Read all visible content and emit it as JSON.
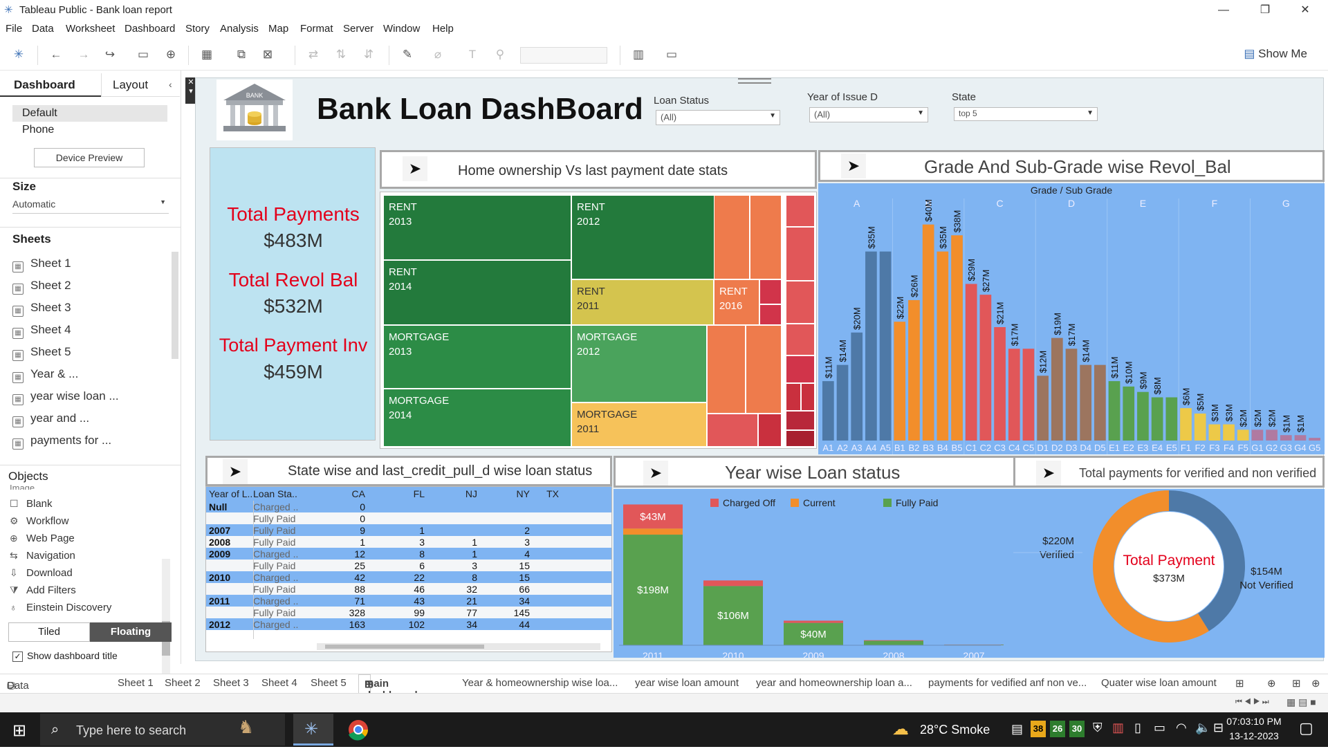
{
  "window": {
    "title": "Tableau Public - Bank loan report",
    "min": "—",
    "max": "❐",
    "close": "✕"
  },
  "menu": [
    "File",
    "Data",
    "Worksheet",
    "Dashboard",
    "Story",
    "Analysis",
    "Map",
    "Format",
    "Server",
    "Window",
    "Help"
  ],
  "toolbar": {
    "show_me": "Show Me"
  },
  "left": {
    "tab_dashboard": "Dashboard",
    "tab_layout": "Layout",
    "device_default": "Default",
    "device_phone": "Phone",
    "device_preview": "Device Preview",
    "size_header": "Size",
    "size_value": "Automatic",
    "sheets_header": "Sheets",
    "sheets": [
      "Sheet 1",
      "Sheet 2",
      "Sheet 3",
      "Sheet 4",
      "Sheet 5",
      "Year & ...",
      "year wise loan ...",
      "year and ...",
      "payments for ..."
    ],
    "objects_header": "Objects",
    "objects_partial": "Image",
    "objects": [
      "Blank",
      "Workflow",
      "Web Page",
      "Navigation",
      "Download",
      "Add Filters",
      "Einstein Discovery"
    ],
    "tiled": "Tiled",
    "floating": "Floating",
    "show_title": "Show dashboard title"
  },
  "dashboard": {
    "title": "Bank Loan DashBoard",
    "logo_text": "BANK",
    "filters": [
      {
        "label": "Loan Status",
        "value": "(All)"
      },
      {
        "label": "Year of Issue D",
        "value": "(All)"
      },
      {
        "label": "State",
        "value": "top 5"
      }
    ],
    "kpis": [
      {
        "label": "Total Payments",
        "value": "$483M"
      },
      {
        "label": "Total Revol Bal",
        "value": "$532M"
      },
      {
        "label": "Total Payment Inv",
        "value": "$459M"
      }
    ],
    "nav_icon": "navigate-arrow-icon",
    "treemap_title": "Home ownership Vs last payment date stats",
    "treemap_cells": [
      {
        "l1": "RENT",
        "l2": "2013",
        "color": "#237a3c"
      },
      {
        "l1": "RENT",
        "l2": "2012",
        "color": "#237a3c"
      },
      {
        "l1": "RENT",
        "l2": "2014",
        "color": "#237a3c"
      },
      {
        "l1": "RENT",
        "l2": "2011",
        "color": "#d4c44e"
      },
      {
        "l1": "RENT",
        "l2": "2016",
        "color": "#ee7b4c"
      },
      {
        "l1": "MORTGAGE",
        "l2": "2013",
        "color": "#2c8c46"
      },
      {
        "l1": "MORTGAGE",
        "l2": "2012",
        "color": "#4aa35c"
      },
      {
        "l1": "MORTGAGE",
        "l2": "2014",
        "color": "#2c8c46"
      },
      {
        "l1": "MORTGAGE",
        "l2": "2011",
        "color": "#f6c25a"
      }
    ],
    "grade_title": "Grade And Sub-Grade wise Revol_Bal",
    "grade_header": "Grade / Sub Grade",
    "state_title": "State wise and last_credit_pull_d wise loan status",
    "state_table": {
      "headers": [
        "Year of L..",
        "Loan Sta..",
        "CA",
        "FL",
        "NJ",
        "NY",
        "TX"
      ],
      "rows": [
        [
          "Null",
          "Charged ..",
          "0",
          "",
          "",
          ""
        ],
        [
          "",
          "Fully Paid",
          "0",
          "",
          "",
          ""
        ],
        [
          "2007",
          "Fully Paid",
          "9",
          "1",
          "",
          "2"
        ],
        [
          "2008",
          "Fully Paid",
          "1",
          "3",
          "1",
          "3"
        ],
        [
          "2009",
          "Charged ..",
          "12",
          "8",
          "1",
          "4"
        ],
        [
          "",
          "Fully Paid",
          "25",
          "6",
          "3",
          "15"
        ],
        [
          "2010",
          "Charged ..",
          "42",
          "22",
          "8",
          "15"
        ],
        [
          "",
          "Fully Paid",
          "88",
          "46",
          "32",
          "66"
        ],
        [
          "2011",
          "Charged ..",
          "71",
          "43",
          "21",
          "34"
        ],
        [
          "",
          "Fully Paid",
          "328",
          "99",
          "77",
          "145"
        ],
        [
          "2012",
          "Charged ..",
          "163",
          "102",
          "34",
          "44"
        ]
      ]
    },
    "year_title": "Year wise Loan status",
    "verified_title": "Total payments for verified and non verified",
    "donut_center_label": "Total Payment",
    "donut_center_value": "$373M"
  },
  "chart_data": [
    {
      "type": "bar",
      "title": "Grade And Sub-Grade wise Revol_Bal",
      "xlabel": "Grade / Sub Grade",
      "groups": [
        "A",
        "B",
        "C",
        "D",
        "E",
        "F",
        "G"
      ],
      "categories": [
        "A1",
        "A2",
        "A3",
        "A4",
        "A5",
        "B1",
        "B2",
        "B3",
        "B4",
        "B5",
        "C1",
        "C2",
        "C3",
        "C4",
        "C5",
        "D1",
        "D2",
        "D3",
        "D4",
        "D5",
        "E1",
        "E2",
        "E3",
        "E4",
        "E5",
        "F1",
        "F2",
        "F3",
        "F4",
        "F5",
        "G1",
        "G2",
        "G3",
        "G4",
        "G5"
      ],
      "values": [
        11,
        14,
        20,
        35,
        35,
        22,
        26,
        40,
        35,
        38,
        29,
        27,
        21,
        17,
        17,
        12,
        19,
        17,
        14,
        14,
        11,
        10,
        9,
        8,
        8,
        6,
        5,
        3,
        3,
        2,
        2,
        2,
        1,
        1,
        0.5
      ],
      "labels": [
        "$11M",
        "$14M",
        "$20M",
        "$35M",
        "",
        "$22M",
        "$26M",
        "$40M",
        "$35M",
        "$38M",
        "$29M",
        "$27M",
        "$21M",
        "$17M",
        "",
        "$12M",
        "$19M",
        "$17M",
        "$14M",
        "",
        "$11M",
        "$10M",
        "$9M",
        "$8M",
        "",
        "$6M",
        "$5M",
        "$3M",
        "$3M",
        "$2M",
        "$2M",
        "$2M",
        "$1M",
        "$1M",
        ""
      ],
      "group_colors": {
        "A": "#4e79a7",
        "B": "#f28e2b",
        "C": "#e15759",
        "D": "#9c755f",
        "E": "#59a14f",
        "F": "#edc948",
        "G": "#b07aa1"
      }
    },
    {
      "type": "bar",
      "title": "Year wise Loan status",
      "categories": [
        "2011",
        "2010",
        "2009",
        "2008",
        "2007"
      ],
      "legend": [
        "Charged Off",
        "Current",
        "Fully Paid"
      ],
      "colors": [
        "#e15759",
        "#f28e2b",
        "#59a14f"
      ],
      "series": [
        {
          "name": "Charged Off",
          "values": [
            43,
            10,
            4,
            1,
            0.3
          ]
        },
        {
          "name": "Current",
          "values": [
            11,
            0,
            0,
            0,
            0
          ]
        },
        {
          "name": "Fully Paid",
          "values": [
            198,
            106,
            40,
            8,
            1
          ]
        }
      ],
      "labels_top": [
        "$43M",
        "",
        "",
        "",
        ""
      ],
      "labels_mid": [
        "$198M",
        "$106M",
        "$40M",
        "",
        ""
      ]
    },
    {
      "type": "pie",
      "title": "Total payments for verified and non verified",
      "categories": [
        "Verified",
        "Not Verified"
      ],
      "values": [
        220,
        154
      ],
      "value_labels": [
        "$220M",
        "$154M"
      ],
      "colors": [
        "#f28e2b",
        "#4e79a7"
      ]
    }
  ],
  "tabs": [
    "Data Source",
    "Sheet 1",
    "Sheet 2",
    "Sheet 3",
    "Sheet 4",
    "Sheet 5",
    "main dashboard",
    "Year & homeownership wise loa...",
    "year wise loan amount",
    "year and homeownership loan a...",
    "payments for vedified anf non ve...",
    "Quater wise loan amount"
  ],
  "taskbar": {
    "search": "Type here to search",
    "weather": "28°C  Smoke",
    "time": "07:03:10 PM",
    "date": "13-12-2023",
    "badges": [
      "38",
      "26",
      "30"
    ]
  }
}
